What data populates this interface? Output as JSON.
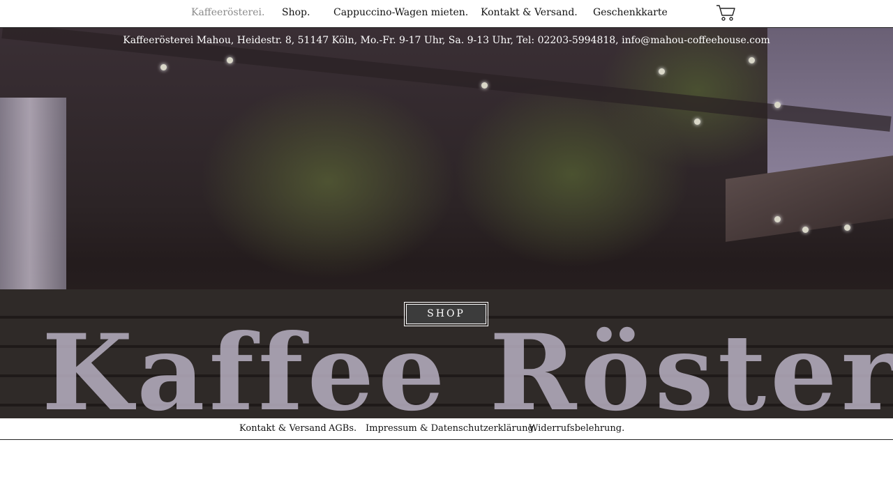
{
  "nav": {
    "items": [
      {
        "label": "Kaffeerösterei.",
        "active": true
      },
      {
        "label": "Shop.",
        "active": false
      },
      {
        "label": "Cappuccino-Wagen mieten.",
        "active": false
      },
      {
        "label": "Kontakt & Versand.",
        "active": false
      },
      {
        "label": "Geschenkkarte",
        "active": false
      }
    ],
    "cart_icon": "shopping-cart-icon"
  },
  "hero": {
    "info": "Kaffeerösterei Mahou, Heidestr. 8, 51147 Köln, Mo.-Fr. 9-17 Uhr, Sa. 9-13 Uhr, Tel: 02203-5994818, info@mahou-coffeehouse.com",
    "sign_text": "Kaffee Rösterei",
    "shop_button": "SHOP"
  },
  "footer": {
    "links": [
      "Kontakt & Versand",
      "AGBs.",
      "Impressum & Datenschutzerklärung.",
      "Widerrufsbelehrung."
    ]
  },
  "colors": {
    "nav_active": "#8a8a8a",
    "button_bg": "#3c3c3c"
  }
}
